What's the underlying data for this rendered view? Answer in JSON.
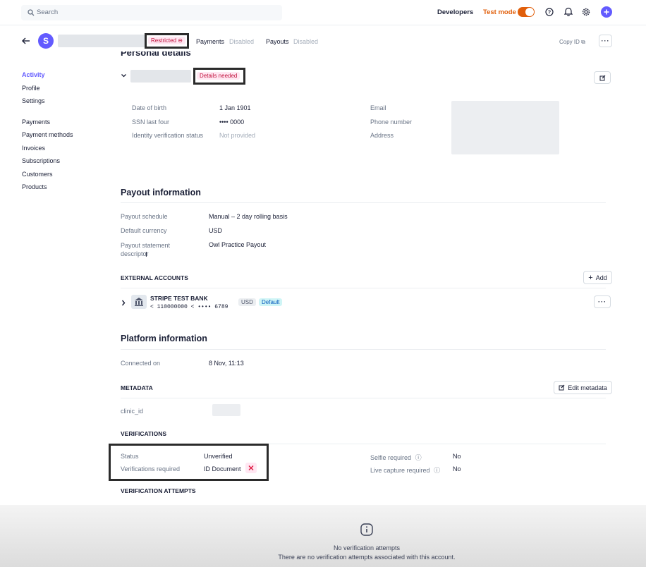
{
  "topbar": {
    "search_placeholder": "Search",
    "developers": "Developers",
    "test_mode": "Test mode",
    "accent": "#635bff",
    "test_mode_color": "#e15f0b"
  },
  "account_header": {
    "avatar_letter": "S",
    "restricted": "Restricted",
    "payments_label": "Payments",
    "payments_status": "Disabled",
    "payouts_label": "Payouts",
    "payouts_status": "Disabled",
    "copy_id": "Copy ID"
  },
  "sidebar": {
    "group1": [
      "Activity",
      "Profile",
      "Settings"
    ],
    "group2": [
      "Payments",
      "Payment methods",
      "Invoices",
      "Subscriptions",
      "Customers",
      "Products"
    ]
  },
  "personal": {
    "title": "Personal details",
    "details_badge": "Details needed",
    "rows_left": [
      {
        "label": "Date of birth",
        "value": "1 Jan 1901"
      },
      {
        "label": "SSN last four",
        "value": "•••• 0000"
      },
      {
        "label": "Identity verification status",
        "value": "Not provided"
      }
    ],
    "rows_right": [
      "Email",
      "Phone number",
      "Address"
    ]
  },
  "payout": {
    "title": "Payout information",
    "rows": [
      {
        "label": "Payout schedule",
        "value": "Manual – 2 day rolling basis"
      },
      {
        "label": "Default currency",
        "value": "USD"
      },
      {
        "label": "Payout statement descriptor",
        "value": "Owl Practice Payout"
      }
    ],
    "external_accounts": "EXTERNAL ACCOUNTS",
    "add": "Add",
    "bank": {
      "name": "STRIPE TEST BANK",
      "number": "< 110000000 < •••• 6789",
      "currency": "USD",
      "default": "Default"
    }
  },
  "platform": {
    "title": "Platform information",
    "connected_label": "Connected on",
    "connected_value": "8 Nov, 11:13",
    "metadata": "METADATA",
    "edit_metadata": "Edit metadata",
    "clinic_id_label": "clinic_id",
    "verifications": "VERIFICATIONS",
    "status_label": "Status",
    "status_value": "Unverified",
    "required_label": "Verifications required",
    "required_value": "ID Document",
    "selfie_label": "Selfie required",
    "selfie_value": "No",
    "live_label": "Live capture required",
    "live_value": "No",
    "attempts": "VERIFICATION ATTEMPTS",
    "no_attempts_title": "No verification attempts",
    "no_attempts_desc": "There are no verification attempts associated with this account."
  }
}
